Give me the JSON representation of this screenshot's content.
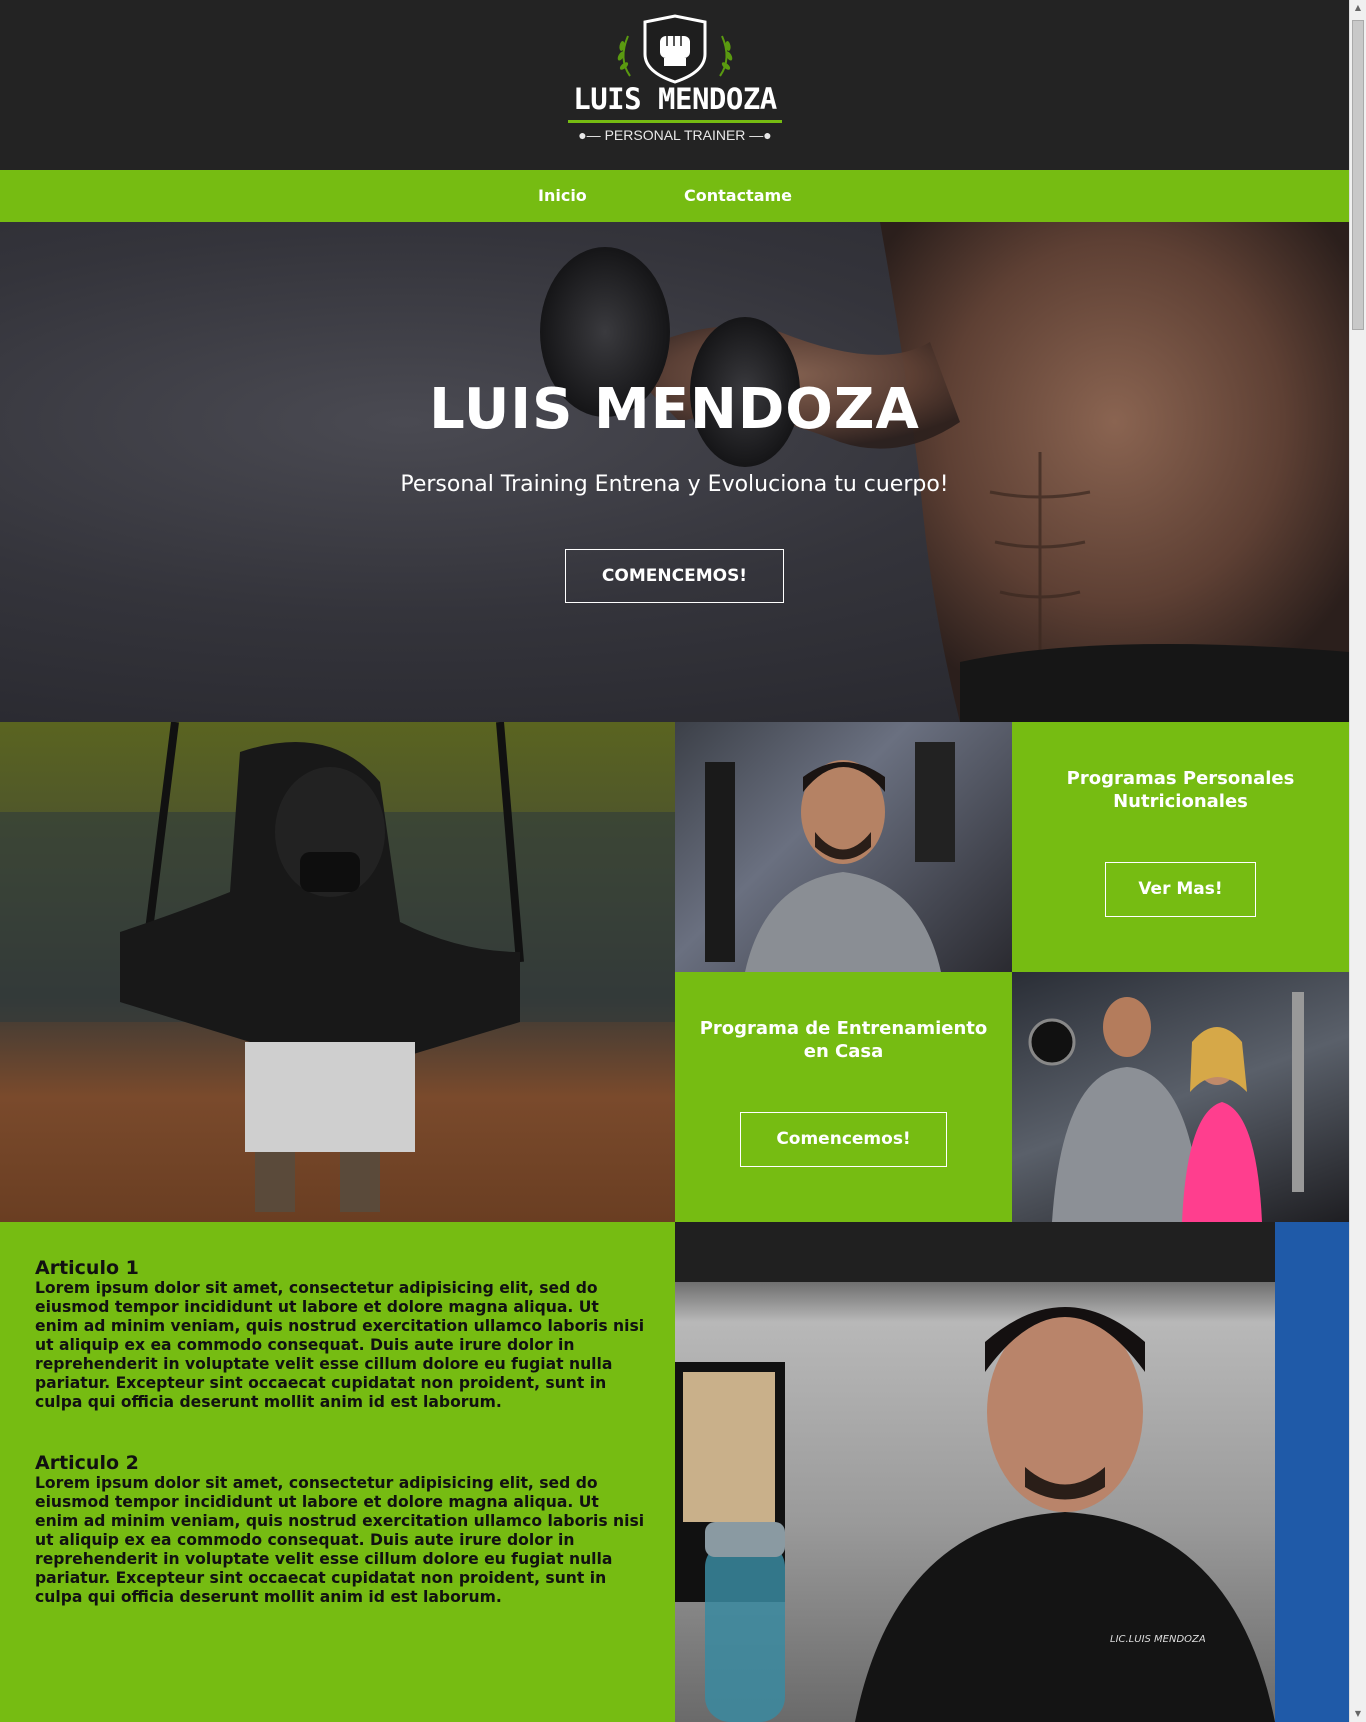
{
  "header": {
    "logo_title": "LUIS MENDOZA",
    "logo_subtitle": "PERSONAL TRAINER"
  },
  "nav": {
    "items": [
      {
        "label": "Inicio"
      },
      {
        "label": "Contactame"
      }
    ]
  },
  "hero": {
    "title": "LUIS MENDOZA",
    "subtitle": "Personal Training Entrena y Evoluciona tu cuerpo!",
    "button": "COMENCEMOS!"
  },
  "tiles": {
    "nutrition": {
      "title": "Programas Personales Nutricionales",
      "button": "Ver Mas!"
    },
    "home_training": {
      "title": "Programa de Entrenamiento en Casa",
      "button": "Comencemos!"
    }
  },
  "articles": [
    {
      "title": "Articulo 1",
      "body": "Lorem ipsum dolor sit amet, consectetur adipisicing elit, sed do eiusmod tempor incididunt ut labore et dolore magna aliqua. Ut enim ad minim veniam, quis nostrud exercitation ullamco laboris nisi ut aliquip ex ea commodo consequat. Duis aute irure dolor in reprehenderit in voluptate velit esse cillum dolore eu fugiat nulla pariatur. Excepteur sint occaecat cupidatat non proident, sunt in culpa qui officia deserunt mollit anim id est laborum."
    },
    {
      "title": "Articulo 2",
      "body": "Lorem ipsum dolor sit amet, consectetur adipisicing elit, sed do eiusmod tempor incididunt ut labore et dolore magna aliqua. Ut enim ad minim veniam, quis nostrud exercitation ullamco laboris nisi ut aliquip ex ea commodo consequat. Duis aute irure dolor in reprehenderit in voluptate velit esse cillum dolore eu fugiat nulla pariatur. Excepteur sint occaecat cupidatat non proident, sunt in culpa qui officia deserunt mollit anim id est laborum."
    }
  ],
  "photo_caption": "LIC.LUIS MENDOZA",
  "colors": {
    "brand_green": "#76bc12",
    "header_dark": "#232323"
  }
}
